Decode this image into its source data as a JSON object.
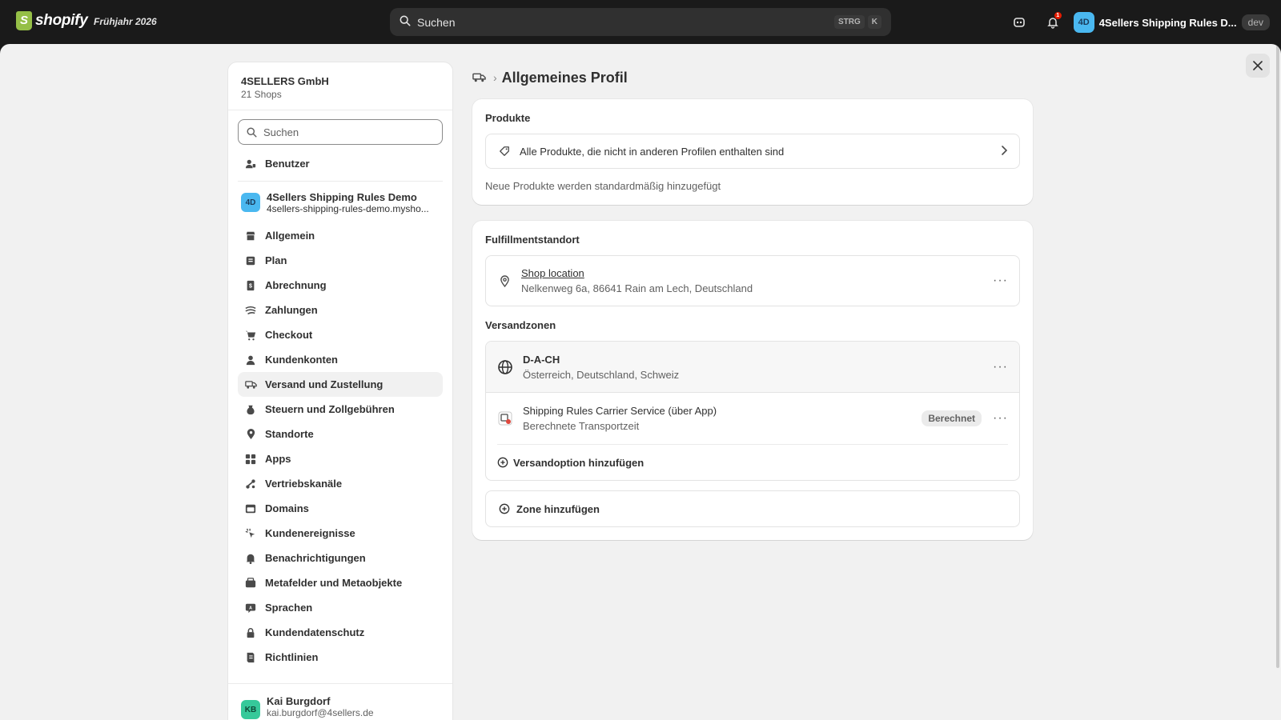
{
  "topbar": {
    "logo_text": "shopify",
    "season": "Frühjahr 2026",
    "search_placeholder": "Suchen",
    "kbd_ctrl": "STRG",
    "kbd_k": "K",
    "notification_count": "1",
    "store_initials": "4D",
    "store_name": "4Sellers Shipping Rules D...",
    "dev_badge": "dev"
  },
  "sidebar": {
    "org_name": "4SELLERS GmbH",
    "org_sub": "21 Shops",
    "search_placeholder": "Suchen",
    "users_label": "Benutzer",
    "store": {
      "initials": "4D",
      "name": "4Sellers Shipping Rules Demo",
      "domain": "4sellers-shipping-rules-demo.mysho..."
    },
    "items": [
      {
        "label": "Allgemein",
        "icon": "store-icon"
      },
      {
        "label": "Plan",
        "icon": "plan-icon"
      },
      {
        "label": "Abrechnung",
        "icon": "billing-icon"
      },
      {
        "label": "Zahlungen",
        "icon": "payments-icon"
      },
      {
        "label": "Checkout",
        "icon": "cart-icon"
      },
      {
        "label": "Kundenkonten",
        "icon": "person-icon"
      },
      {
        "label": "Versand und Zustellung",
        "icon": "truck-icon"
      },
      {
        "label": "Steuern und Zollgebühren",
        "icon": "tax-icon"
      },
      {
        "label": "Standorte",
        "icon": "location-icon"
      },
      {
        "label": "Apps",
        "icon": "apps-icon"
      },
      {
        "label": "Vertriebskanäle",
        "icon": "channels-icon"
      },
      {
        "label": "Domains",
        "icon": "domains-icon"
      },
      {
        "label": "Kundenereignisse",
        "icon": "events-icon"
      },
      {
        "label": "Benachrichtigungen",
        "icon": "bell-icon"
      },
      {
        "label": "Metafelder und Metaobjekte",
        "icon": "metafields-icon"
      },
      {
        "label": "Sprachen",
        "icon": "language-icon"
      },
      {
        "label": "Kundendatenschutz",
        "icon": "lock-icon"
      },
      {
        "label": "Richtlinien",
        "icon": "policy-icon"
      }
    ],
    "active_item": "Versand und Zustellung",
    "user": {
      "initials": "KB",
      "name": "Kai Burgdorf",
      "email": "kai.burgdorf@4sellers.de"
    }
  },
  "page": {
    "title": "Allgemeines Profil",
    "products_card": {
      "title": "Produkte",
      "row_text": "Alle Produkte, die nicht in anderen Profilen enthalten sind",
      "helper": "Neue Produkte werden standardmäßig hinzugefügt"
    },
    "fulfillment_card": {
      "title": "Fulfillmentstandort",
      "location_name": "Shop location",
      "location_address": "Nelkenweg 6a, 86641 Rain am Lech, Deutschland",
      "zones_title": "Versandzonen",
      "zone": {
        "name": "D-A-CH",
        "countries": "Österreich, Deutschland, Schweiz"
      },
      "rate": {
        "name": "Shipping Rules Carrier Service (über App)",
        "sub": "Berechnete Transportzeit",
        "badge": "Berechnet"
      },
      "add_rate": "Versandoption hinzufügen",
      "add_zone": "Zone hinzufügen"
    }
  }
}
